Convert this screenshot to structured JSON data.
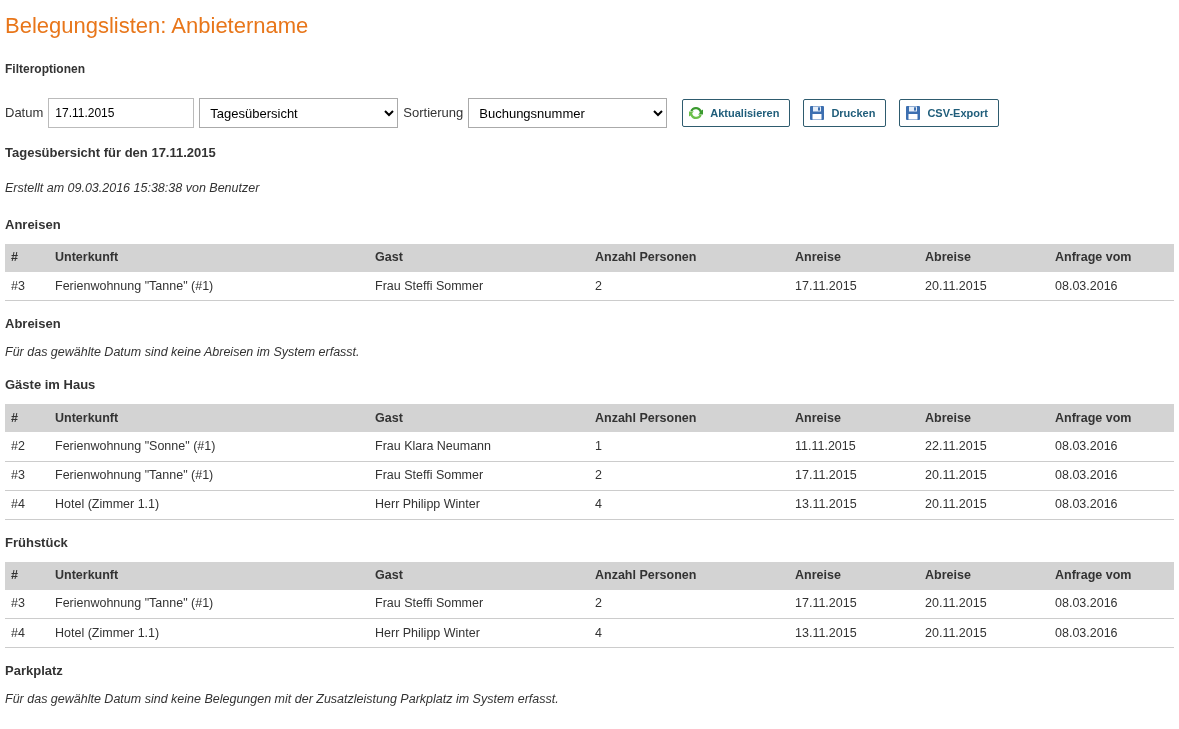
{
  "title": "Belegungslisten: Anbietername",
  "filter": {
    "heading": "Filteroptionen",
    "date_label": "Datum",
    "date_value": "17.11.2015",
    "view_value": "Tagesübersicht",
    "sort_label": "Sortierung",
    "sort_value": "Buchungsnummer",
    "buttons": [
      {
        "label": "Aktualisieren",
        "kind": "refresh"
      },
      {
        "label": "Drucken",
        "kind": "save"
      },
      {
        "label": "CSV-Export",
        "kind": "save"
      }
    ]
  },
  "overview_heading": "Tagesübersicht für den 17.11.2015",
  "created_note": "Erstellt am 09.03.2016 15:38:38 von Benutzer",
  "sections": [
    {
      "heading": "Anreisen",
      "kind": "table",
      "columns": [
        "#",
        "Unterkunft",
        "Gast",
        "Anzahl Personen",
        "Anreise",
        "Abreise",
        "Anfrage vom"
      ],
      "rows": [
        [
          "#3",
          "Ferienwohnung \"Tanne\" (#1)",
          "Frau Steffi Sommer",
          "2",
          "17.11.2015",
          "20.11.2015",
          "08.03.2016"
        ]
      ]
    },
    {
      "heading": "Abreisen",
      "kind": "empty",
      "message": "Für das gewählte Datum sind keine Abreisen im System erfasst."
    },
    {
      "heading": "Gäste im Haus",
      "kind": "table",
      "columns": [
        "#",
        "Unterkunft",
        "Gast",
        "Anzahl Personen",
        "Anreise",
        "Abreise",
        "Anfrage vom"
      ],
      "rows": [
        [
          "#2",
          "Ferienwohnung \"Sonne\" (#1)",
          "Frau Klara Neumann",
          "1",
          "11.11.2015",
          "22.11.2015",
          "08.03.2016"
        ],
        [
          "#3",
          "Ferienwohnung \"Tanne\" (#1)",
          "Frau Steffi Sommer",
          "2",
          "17.11.2015",
          "20.11.2015",
          "08.03.2016"
        ],
        [
          "#4",
          "Hotel (Zimmer 1.1)",
          "Herr Philipp Winter",
          "4",
          "13.11.2015",
          "20.11.2015",
          "08.03.2016"
        ]
      ]
    },
    {
      "heading": "Frühstück",
      "kind": "table",
      "columns": [
        "#",
        "Unterkunft",
        "Gast",
        "Anzahl Personen",
        "Anreise",
        "Abreise",
        "Anfrage vom"
      ],
      "rows": [
        [
          "#3",
          "Ferienwohnung \"Tanne\" (#1)",
          "Frau Steffi Sommer",
          "2",
          "17.11.2015",
          "20.11.2015",
          "08.03.2016"
        ],
        [
          "#4",
          "Hotel (Zimmer 1.1)",
          "Herr Philipp Winter",
          "4",
          "13.11.2015",
          "20.11.2015",
          "08.03.2016"
        ]
      ]
    },
    {
      "heading": "Parkplatz",
      "kind": "empty",
      "message": "Für das gewählte Datum sind keine Belegungen mit der Zusatzleistung Parkplatz im System erfasst."
    }
  ]
}
